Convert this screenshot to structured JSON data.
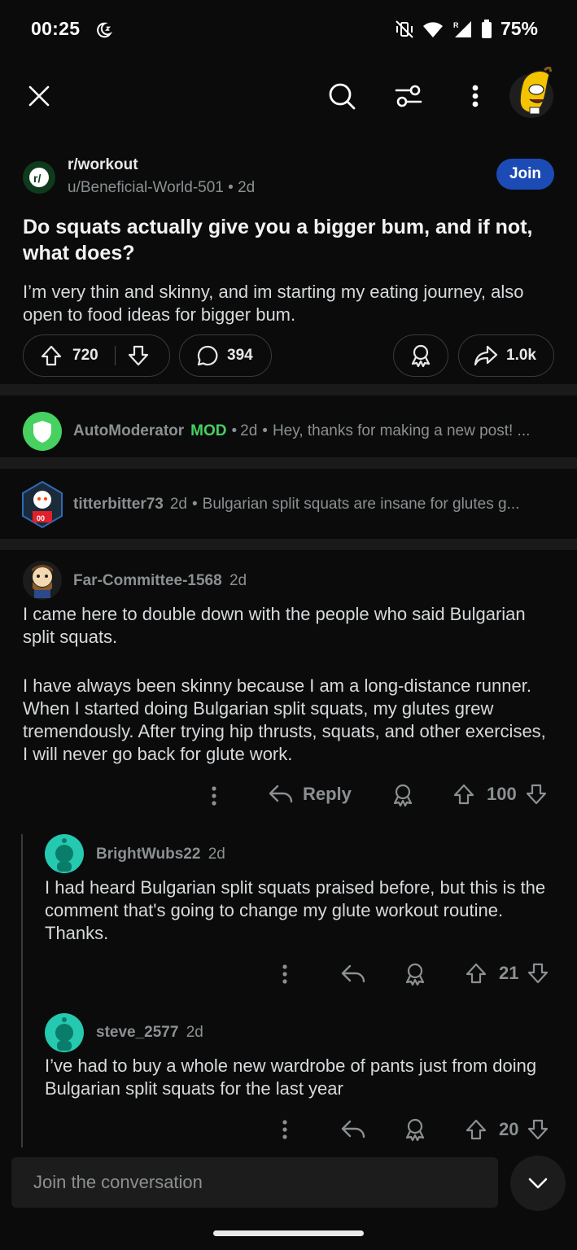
{
  "status": {
    "time": "00:25",
    "battery": "75%"
  },
  "topbar": {
    "icons": [
      "close-icon",
      "search-icon",
      "filter-icon",
      "more-vertical-icon",
      "avatar"
    ]
  },
  "post": {
    "subreddit": "r/workout",
    "author": "u/Beneficial-World-501",
    "age": "2d",
    "join_label": "Join",
    "title": "Do squats actually give you a bigger bum, and if not, what does?",
    "body": "I’m very thin and skinny, and im starting my eating journey, also open to food ideas for bigger bum.",
    "votes": "720",
    "comments": "394",
    "shares": "1.0k"
  },
  "collapsed": [
    {
      "user": "AutoModerator",
      "mod": "MOD",
      "age": "2d",
      "preview": "Hey, thanks for making a new post! ..."
    },
    {
      "user": "titterbitter73",
      "age": "2d",
      "preview": "Bulgarian split squats are insane for glutes g..."
    }
  ],
  "comment": {
    "user": "Far-Committee-1568",
    "age": "2d",
    "para1": "I came here to double down with the people who said Bulgarian split squats.",
    "para2": "I have always been skinny because I am a long-distance runner. When I started doing Bulgarian split squats, my glutes grew tremendously. After trying hip thrusts, squats, and other exercises, I will never go back for glute work.",
    "reply_label": "Reply",
    "votes": "100"
  },
  "replies": [
    {
      "user": "BrightWubs22",
      "age": "2d",
      "text": "I had heard Bulgarian split squats praised before, but this is the comment that's going to change my glute workout routine. Thanks.",
      "votes": "21"
    },
    {
      "user": "steve_2577",
      "age": "2d",
      "text": "I’ve had to buy a whole new wardrobe of pants just from doing Bulgarian split squats for the last year",
      "votes": "20"
    }
  ],
  "composer": {
    "placeholder": "Join the conversation"
  },
  "colors": {
    "background": "#0b0b0b",
    "join": "#1d4bb5",
    "mod": "#46d160",
    "automod": "#46d160",
    "snoo": "#24c9b0"
  }
}
